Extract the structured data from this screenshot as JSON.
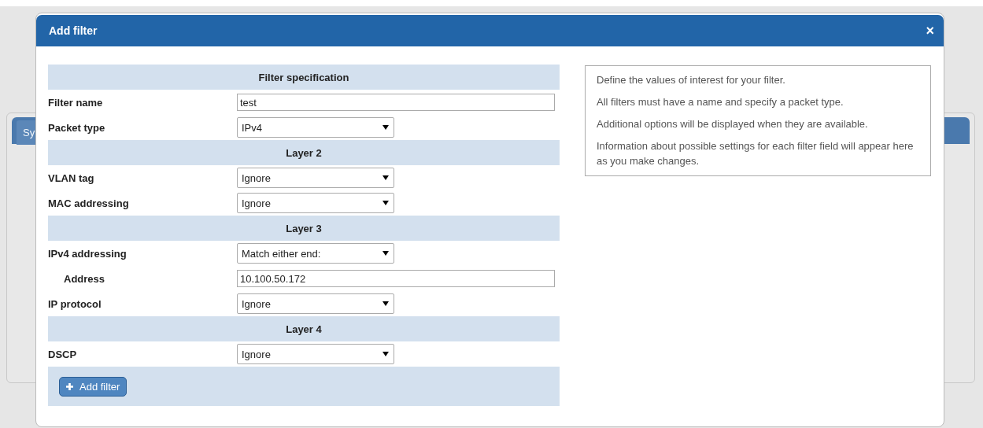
{
  "background": {
    "tab": {
      "label": "Sy"
    }
  },
  "dialog": {
    "title": "Add filter",
    "close": "×"
  },
  "form": {
    "rows": [
      {
        "kind": "header",
        "label": "Filter specification"
      },
      {
        "kind": "text",
        "label": "Filter name",
        "value": "test"
      },
      {
        "kind": "select",
        "label": "Packet type",
        "value": "IPv4"
      },
      {
        "kind": "header",
        "label": "Layer 2"
      },
      {
        "kind": "select",
        "label": "VLAN tag",
        "value": "Ignore"
      },
      {
        "kind": "select",
        "label": "MAC addressing",
        "value": "Ignore"
      },
      {
        "kind": "header",
        "label": "Layer 3"
      },
      {
        "kind": "select",
        "label": "IPv4 addressing",
        "value": "Match either end:"
      },
      {
        "kind": "subtext",
        "label": "Address",
        "value": "10.100.50.172"
      },
      {
        "kind": "select",
        "label": "IP protocol",
        "value": "Ignore"
      },
      {
        "kind": "header",
        "label": "Layer 4"
      },
      {
        "kind": "select",
        "label": "DSCP",
        "value": "Ignore"
      }
    ],
    "button": {
      "label": "Add filter"
    }
  },
  "help": [
    "Define the values of interest for your filter.",
    "All filters must have a name and specify a packet type.",
    "Additional options will be displayed when they are available.",
    "Information about possible settings for each filter field will appear here as you make changes."
  ]
}
